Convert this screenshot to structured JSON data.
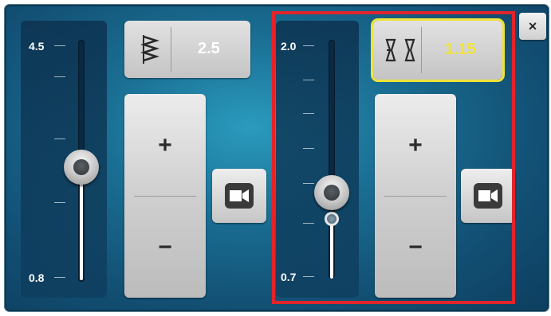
{
  "left_group": {
    "slider": {
      "max_label": "4.5",
      "min_label": "0.8",
      "level": 0.36
    },
    "value_button": {
      "icon": "zigzag-stitch-icon",
      "value": "2.5",
      "value_color": "#ffffff"
    },
    "increment_label": "+",
    "decrement_label": "−",
    "camera_icon": "video-camera-icon"
  },
  "right_group": {
    "slider": {
      "max_label": "2.0",
      "min_label": "0.7",
      "level": 0.34
    },
    "value_button": {
      "icon": "hourglass-bobbin-icon",
      "value": "1.15",
      "value_color": "#f1e33a"
    },
    "increment_label": "+",
    "decrement_label": "−",
    "camera_icon": "video-camera-icon"
  },
  "close_label": "×",
  "colors": {
    "highlight_border": "#e0252b",
    "selected_outline": "#f0e23a"
  }
}
